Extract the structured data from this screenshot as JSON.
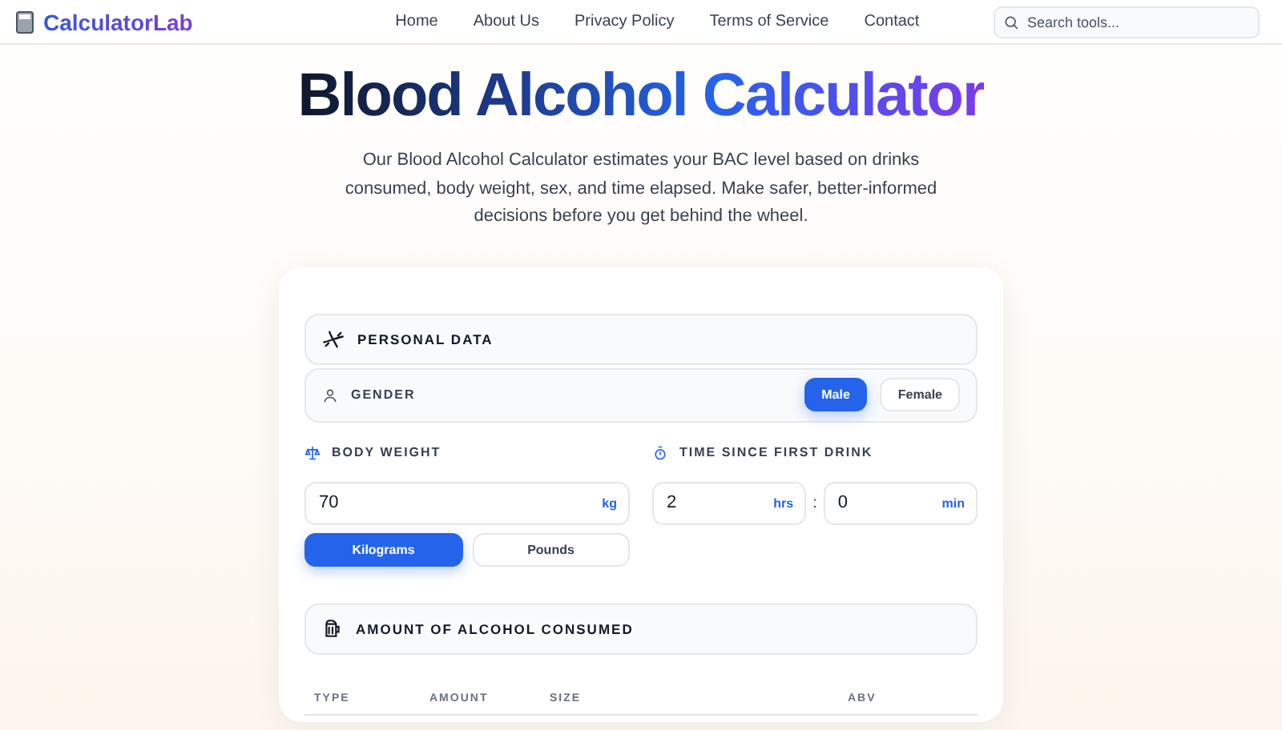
{
  "nav": {
    "logo": "CalculatorLab",
    "links": [
      "Home",
      "About Us",
      "Privacy Policy",
      "Terms of Service",
      "Contact"
    ],
    "search": {
      "placeholder": "Search tools..."
    }
  },
  "hero": {
    "title": "Blood Alcohol Calculator",
    "description": "Our Blood Alcohol Calculator estimates your BAC level based on drinks consumed, body weight, sex, and time elapsed. Make safer, better-informed decisions before you get behind the wheel."
  },
  "personal": {
    "heading": "PERSONAL DATA",
    "gender": {
      "label": "GENDER",
      "options": [
        {
          "label": "Male",
          "selected": true
        },
        {
          "label": "Female",
          "selected": false
        }
      ]
    },
    "weight": {
      "label": "BODY WEIGHT",
      "value": "70",
      "unit": "kg",
      "options": [
        {
          "label": "Kilograms",
          "selected": true
        },
        {
          "label": "Pounds",
          "selected": false
        }
      ]
    },
    "time": {
      "label": "TIME SINCE FIRST DRINK",
      "hours": "2",
      "hours_unit": "hrs",
      "separator": ":",
      "minutes": "0",
      "minutes_unit": "min"
    }
  },
  "alcohol": {
    "heading": "AMOUNT OF ALCOHOL CONSUMED",
    "columns": [
      "TYPE",
      "AMOUNT",
      "SIZE",
      "ABV"
    ]
  }
}
